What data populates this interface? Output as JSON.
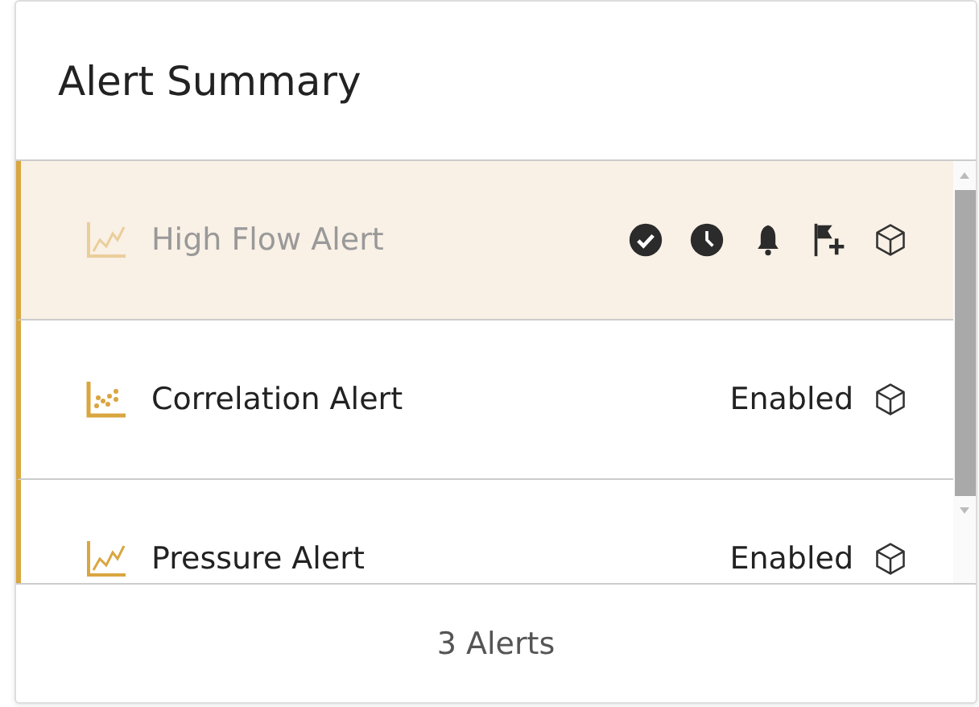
{
  "panel": {
    "title": "Alert Summary"
  },
  "alerts": [
    {
      "name": "High Flow Alert",
      "kind": "line",
      "selected": true
    },
    {
      "name": "Correlation Alert",
      "kind": "scatter",
      "selected": false,
      "status": "Enabled"
    },
    {
      "name": "Pressure Alert",
      "kind": "line",
      "selected": false,
      "status": "Enabled"
    }
  ],
  "footer": {
    "count": "3 Alerts"
  }
}
